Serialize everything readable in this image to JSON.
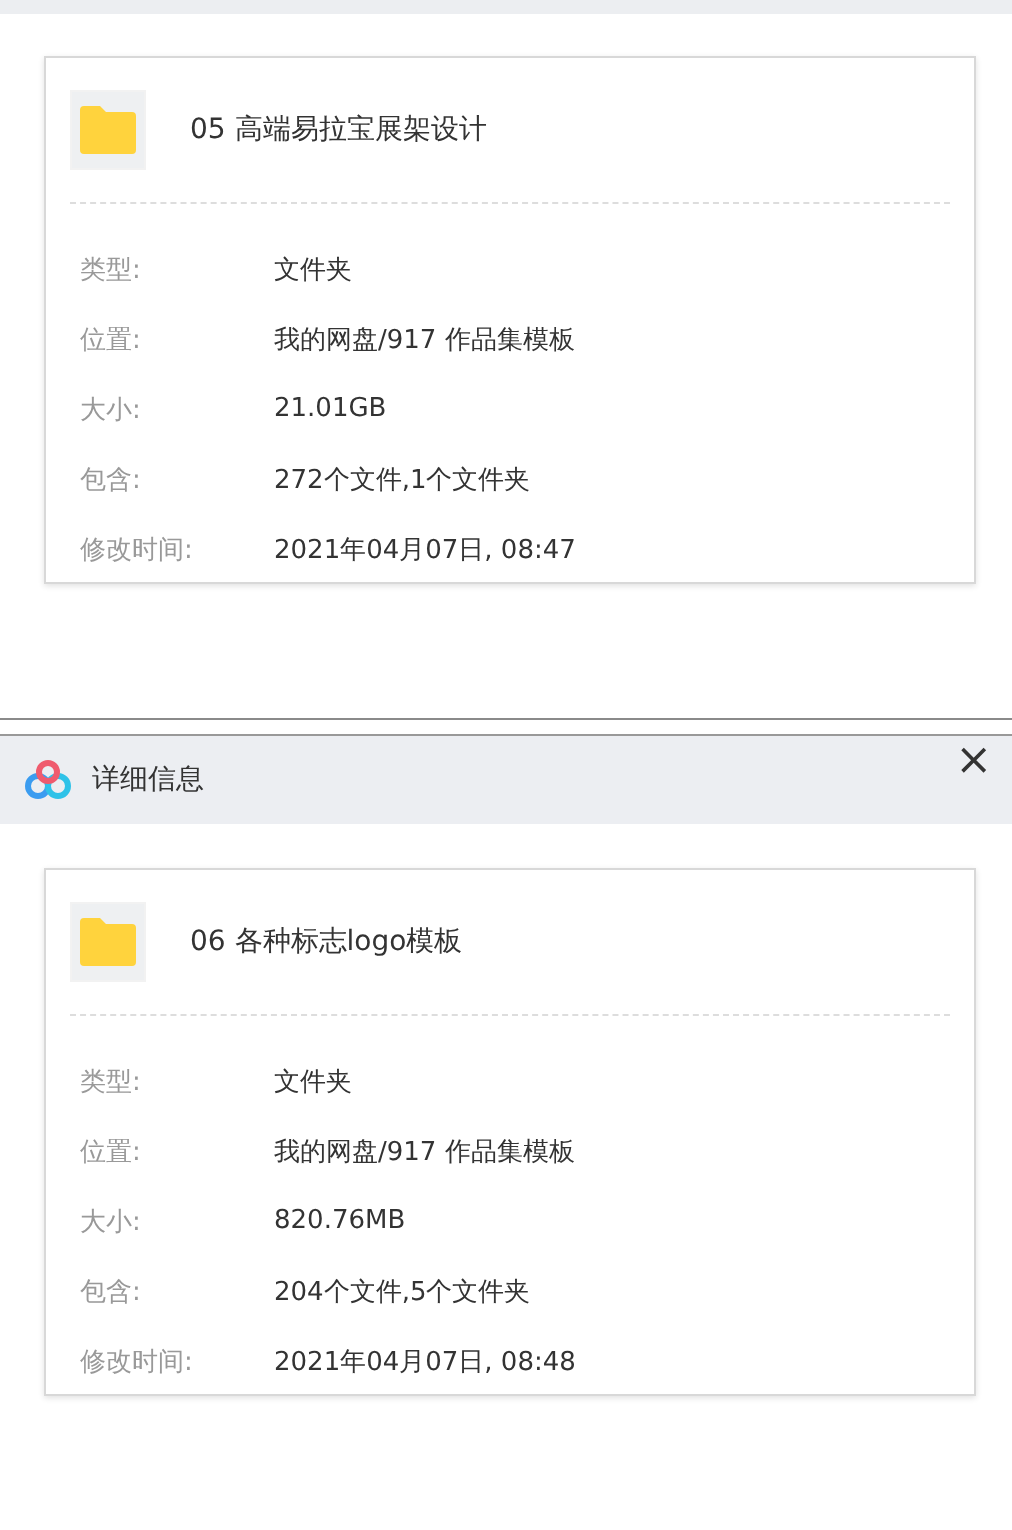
{
  "panels": [
    {
      "file": {
        "name": "05 高端易拉宝展架设计"
      },
      "properties": [
        {
          "label": "类型:",
          "value": "文件夹"
        },
        {
          "label": "位置:",
          "value": "我的网盘/917 作品集模板"
        },
        {
          "label": "大小:",
          "value": "21.01GB"
        },
        {
          "label": "包含:",
          "value": "272个文件,1个文件夹"
        },
        {
          "label": "修改时间:",
          "value": "2021年04月07日, 08:47"
        }
      ]
    },
    {
      "title": "详细信息",
      "close": "×",
      "file": {
        "name": "06 各种标志logo模板"
      },
      "properties": [
        {
          "label": "类型:",
          "value": "文件夹"
        },
        {
          "label": "位置:",
          "value": "我的网盘/917 作品集模板"
        },
        {
          "label": "大小:",
          "value": "820.76MB"
        },
        {
          "label": "包含:",
          "value": "204个文件,5个文件夹"
        },
        {
          "label": "修改时间:",
          "value": "2021年04月07日, 08:48"
        }
      ]
    }
  ]
}
